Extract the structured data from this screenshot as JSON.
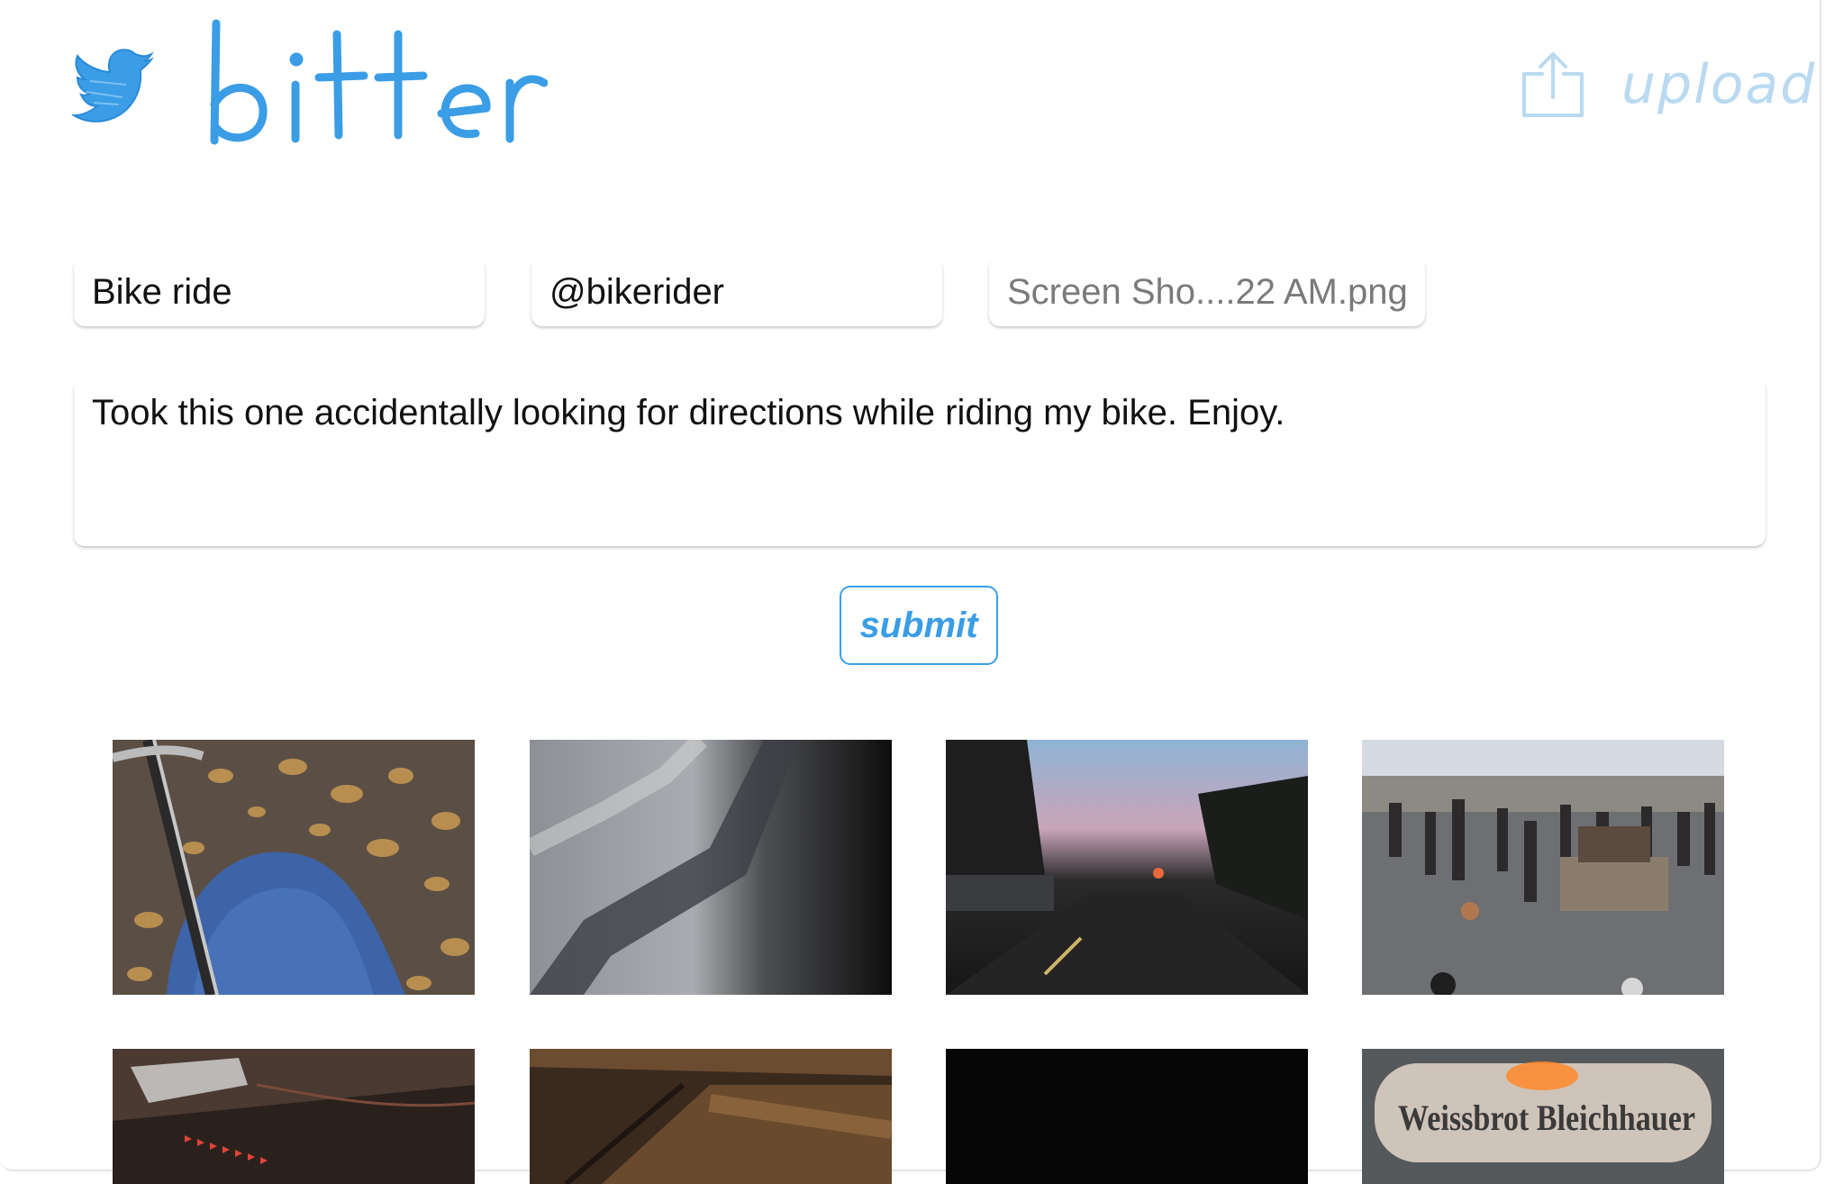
{
  "header": {
    "brand": "bitter",
    "bird_icon": "bird-logo-icon",
    "upload_label": "upload",
    "upload_icon": "upload-icon"
  },
  "form": {
    "title_value": "Bike ride",
    "handle_value": "@bikerider",
    "file_value": "Screen Sho....22 AM.png",
    "body_value": "Took this one accidentally looking for directions while riding my bike. Enjoy.",
    "submit_label": "submit"
  },
  "gallery": {
    "thumbnails": [
      "bike-knee-leaves",
      "blurry-fabric-pattern",
      "street-at-sunset",
      "outdoor-gathering-crowd",
      "blurry-night-light",
      "dim-wooden-surface",
      "dark-black-photo",
      "illuminated-sign"
    ],
    "sign_text": "Weissbrot Bleichhauer"
  },
  "colors": {
    "accent": "#3a9de6",
    "upload_muted": "#b9daf1",
    "background": "#ffffff"
  }
}
